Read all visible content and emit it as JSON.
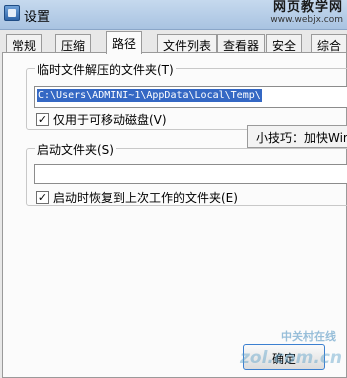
{
  "window": {
    "title": "设置"
  },
  "watermark_top": {
    "line1": "网页教学网",
    "line2": "www.webjx.com"
  },
  "tabs": [
    {
      "label": "常规",
      "active": false
    },
    {
      "label": "压缩",
      "active": false
    },
    {
      "label": "路径",
      "active": true
    },
    {
      "label": "文件列表",
      "active": false
    },
    {
      "label": "查看器",
      "active": false
    },
    {
      "label": "安全",
      "active": false
    },
    {
      "label": "综合",
      "active": false
    }
  ],
  "temp_group": {
    "label": "临时文件解压的文件夹(T)",
    "path_value": "C:\\Users\\ADMINI~1\\AppData\\Local\\Temp\\",
    "checkbox_label": "仅用于可移动磁盘(V)",
    "checked": true
  },
  "start_group": {
    "label": "启动文件夹(S)",
    "path_value": "",
    "checkbox_label": "启动时恢复到上次工作的文件夹(E)",
    "checked": true
  },
  "tooltip": {
    "text": "小技巧：加快Win"
  },
  "ok_button": {
    "label": "确定"
  },
  "watermark_bottom": {
    "line1": "中关村在线",
    "line2": "zol.com.cn"
  }
}
